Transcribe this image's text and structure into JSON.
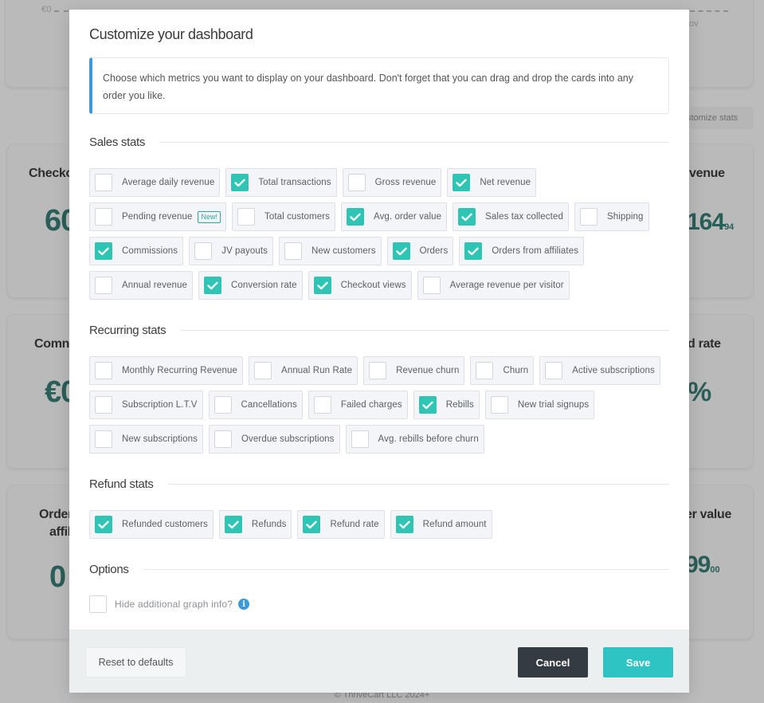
{
  "background": {
    "chart_axis_zero": "€0",
    "chart_axis_right_partial": "ov",
    "customize_stats_label": "stomize stats",
    "cards": [
      {
        "title": "Checko",
        "value": "60",
        "cents": ""
      },
      {
        "title": "venue",
        "value": "164",
        "cents": "94"
      },
      {
        "title": "Comn",
        "value": "€0",
        "cents": ""
      },
      {
        "title": "d rate",
        "value": "%",
        "cents": ""
      },
      {
        "title_line1": "Order",
        "title_line2": "affil",
        "value": "0",
        "cents": ""
      },
      {
        "title": "er value",
        "value": "99",
        "cents": "00"
      }
    ],
    "footer": "© ThriveCart LLC 2024+"
  },
  "modal": {
    "title": "Customize your dashboard",
    "info_text": "Choose which metrics you want to display on your dashboard. Don't forget that you can drag and drop the cards into any order you like.",
    "accent_color": "#2fc4b3",
    "sections": [
      {
        "label": "Sales stats",
        "items": [
          {
            "label": "Average daily revenue",
            "checked": false
          },
          {
            "label": "Total transactions",
            "checked": true
          },
          {
            "label": "Gross revenue",
            "checked": false
          },
          {
            "label": "Net revenue",
            "checked": true
          },
          {
            "label": "Pending revenue",
            "checked": false,
            "badge": "New!"
          },
          {
            "label": "Total customers",
            "checked": false
          },
          {
            "label": "Avg. order value",
            "checked": true
          },
          {
            "label": "Sales tax collected",
            "checked": true
          },
          {
            "label": "Shipping",
            "checked": false
          },
          {
            "label": "Commissions",
            "checked": true
          },
          {
            "label": "JV payouts",
            "checked": false
          },
          {
            "label": "New customers",
            "checked": false
          },
          {
            "label": "Orders",
            "checked": true
          },
          {
            "label": "Orders from affiliates",
            "checked": true
          },
          {
            "label": "Annual revenue",
            "checked": false
          },
          {
            "label": "Conversion rate",
            "checked": true
          },
          {
            "label": "Checkout views",
            "checked": true
          },
          {
            "label": "Average revenue per visitor",
            "checked": false
          }
        ]
      },
      {
        "label": "Recurring stats",
        "items": [
          {
            "label": "Monthly Recurring Revenue",
            "checked": false
          },
          {
            "label": "Annual Run Rate",
            "checked": false
          },
          {
            "label": "Revenue churn",
            "checked": false
          },
          {
            "label": "Churn",
            "checked": false
          },
          {
            "label": "Active subscriptions",
            "checked": false
          },
          {
            "label": "Subscription L.T.V",
            "checked": false
          },
          {
            "label": "Cancellations",
            "checked": false
          },
          {
            "label": "Failed charges",
            "checked": false
          },
          {
            "label": "Rebills",
            "checked": true
          },
          {
            "label": "New trial signups",
            "checked": false
          },
          {
            "label": "New subscriptions",
            "checked": false
          },
          {
            "label": "Overdue subscriptions",
            "checked": false
          },
          {
            "label": "Avg. rebills before churn",
            "checked": false
          }
        ]
      },
      {
        "label": "Refund stats",
        "items": [
          {
            "label": "Refunded customers",
            "checked": true
          },
          {
            "label": "Refunds",
            "checked": true
          },
          {
            "label": "Refund rate",
            "checked": true
          },
          {
            "label": "Refund amount",
            "checked": true
          }
        ]
      }
    ],
    "options": {
      "label": "Options",
      "hide_graph_info": {
        "label": "Hide additional graph info?",
        "checked": false,
        "icon": "info-icon"
      }
    },
    "footer": {
      "reset_label": "Reset to defaults",
      "cancel_label": "Cancel",
      "save_label": "Save"
    }
  }
}
